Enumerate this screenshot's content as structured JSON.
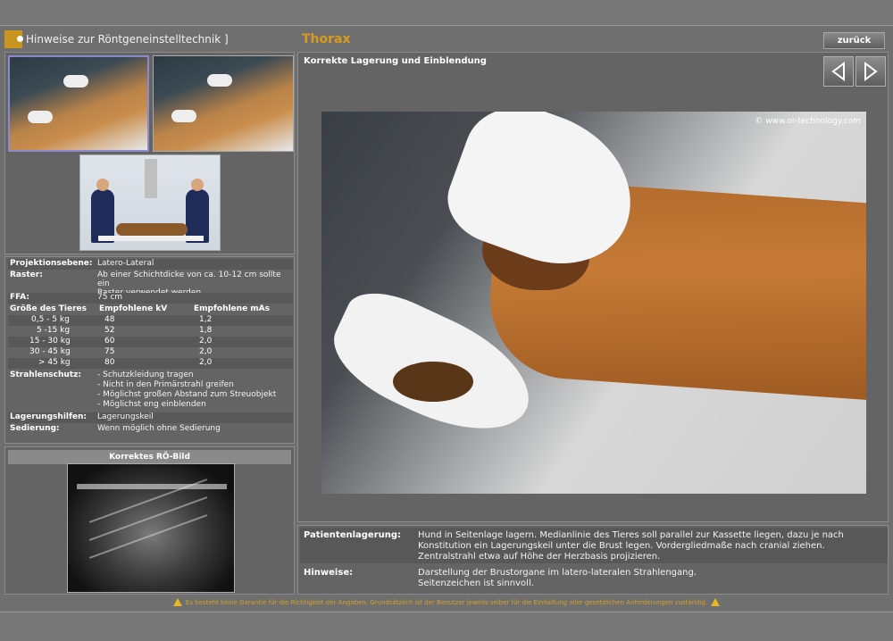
{
  "header": {
    "nav_label": "Hinweise zur Röntgeneinstelltechnik ]",
    "title": "Thorax",
    "back_label": "zurück"
  },
  "main": {
    "subtitle": "Korrekte Lagerung und Einblendung",
    "copyright": "© www.or-technology.com"
  },
  "info": {
    "projektionsebene": {
      "label": "Projektionsebene:",
      "value": "Latero-Lateral"
    },
    "raster": {
      "label": "Raster:",
      "value_line1": "Ab einer Schichtdicke von ca. 10-12 cm sollte ein",
      "value_line2": "Raster verwendet werden."
    },
    "ffa": {
      "label": "FFA:",
      "value": "75 cm"
    },
    "table_header": {
      "size": "Größe des Tieres",
      "kv": "Empfohlene kV",
      "mas": "Empfohlene mAs"
    },
    "table_rows": [
      {
        "size": "0,5 - 5 kg",
        "kv": "48",
        "mas": "1,2"
      },
      {
        "size": "5 -15 kg",
        "kv": "52",
        "mas": "1,8"
      },
      {
        "size": "15 - 30 kg",
        "kv": "60",
        "mas": "2,0"
      },
      {
        "size": "30 - 45 kg",
        "kv": "75",
        "mas": "2,0"
      },
      {
        "size": "> 45 kg",
        "kv": "80",
        "mas": "2,0"
      }
    ],
    "strahlenschutz": {
      "label": "Strahlenschutz:",
      "items": [
        "- Schutzkleidung tragen",
        "- Nicht in den Primärstrahl greifen",
        "- Möglichst großen Abstand zum Streuobjekt",
        "- Möglichst eng einblenden"
      ]
    },
    "lagerungshilfen": {
      "label": "Lagerungshilfen:",
      "value": "Lagerungskeil"
    },
    "sedierung": {
      "label": "Sedierung:",
      "value": "Wenn möglich ohne Sedierung"
    }
  },
  "xray": {
    "title": "Korrektes RÖ-Bild"
  },
  "bottom": {
    "patientenlagerung": {
      "label": "Patientenlagerung:",
      "line1": "Hund in Seitenlage lagern. Medianlinie des Tieres soll parallel zur Kassette liegen, dazu je nach",
      "line2": "Konstitution ein Lagerungskeil unter die Brust legen. Vordergliedmaße nach cranial ziehen.",
      "line3": "Zentralstrahl etwa auf Höhe der Herzbasis projizieren."
    },
    "hinweise": {
      "label": "Hinweise:",
      "line1": "Darstellung der Brustorgane im latero-lateralen Strahlengang.",
      "line2": "Seitenzeichen ist sinnvoll."
    }
  },
  "footer": {
    "disclaimer": "Es besteht keine Garantie für die Richtigkeit der Angaben. Grundsätzlich ist der Benutzer jeweils selber für die Einhaltung aller gesetzlichen Anforderungen zuständig."
  },
  "icons": {
    "nav": "info-arrow-icon",
    "prev": "arrow-left-icon",
    "next": "arrow-right-icon",
    "warning": "warning-icon"
  },
  "colors": {
    "accent": "#d89a1a",
    "background": "#6f6f6f"
  }
}
